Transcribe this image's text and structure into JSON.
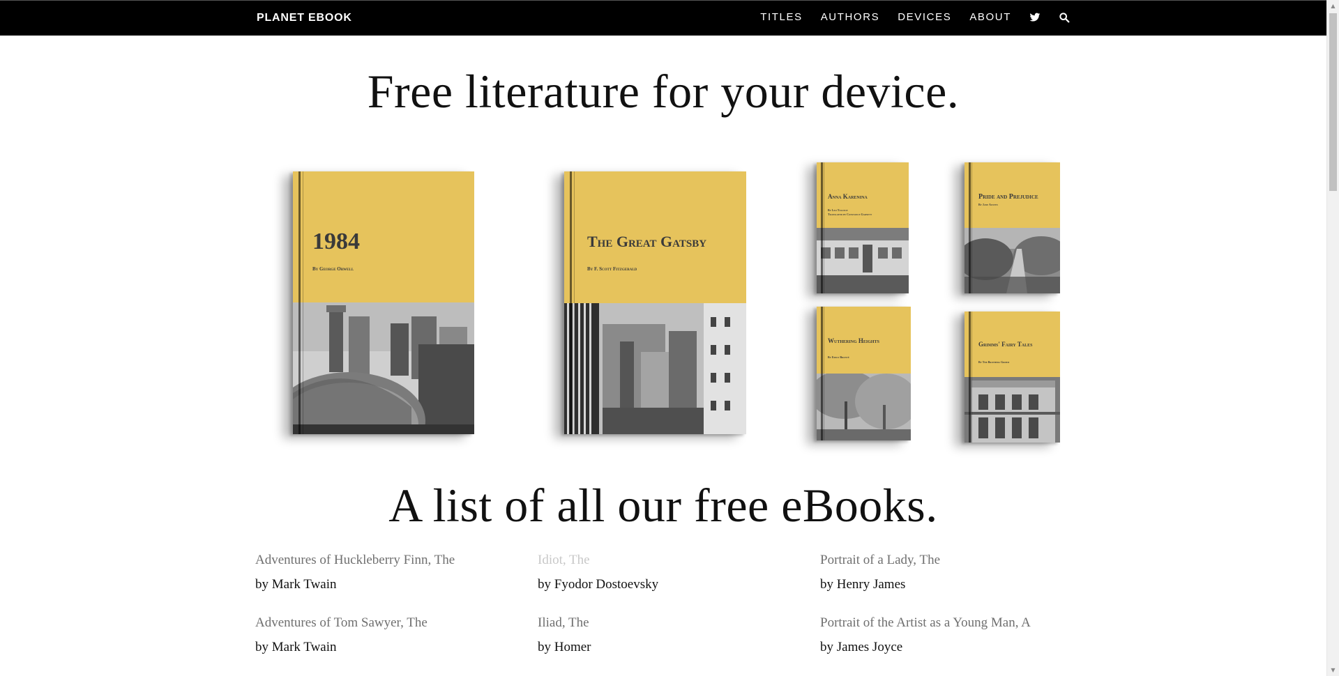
{
  "nav": {
    "brand": "PLANET EBOOK",
    "links": [
      "TITLES",
      "AUTHORS",
      "DEVICES",
      "ABOUT"
    ],
    "icons": [
      "twitter-icon",
      "search-icon"
    ]
  },
  "hero": {
    "title": "Free literature for your device."
  },
  "books": [
    {
      "title": "1984",
      "author": "By George Orwell"
    },
    {
      "title": "The Great Gatsby",
      "author": "By F. Scott Fitzgerald"
    },
    {
      "title": "Anna Karenina",
      "author": "By Leo Tolstoy",
      "author2": "Translated by Constance Garnett"
    },
    {
      "title": "Pride and Prejudice",
      "author": "By Jane Austen"
    },
    {
      "title": "Wuthering Heights",
      "author": "By Emily Brontë"
    },
    {
      "title": "Grimms' Fairy Tales",
      "author": "By The Brothers Grimm"
    }
  ],
  "list": {
    "title": "A list of all our free eBooks.",
    "items": [
      {
        "title": "Adventures of Huckleberry Finn, The",
        "author": "by Mark Twain"
      },
      {
        "title": "Idiot, The",
        "author": "by Fyodor Dostoevsky"
      },
      {
        "title": "Portrait of a Lady, The",
        "author": "by Henry James"
      },
      {
        "title": "Adventures of Tom Sawyer, The",
        "author": "by Mark Twain"
      },
      {
        "title": "Iliad, The",
        "author": "by Homer"
      },
      {
        "title": "Portrait of the Artist as a Young Man, A",
        "author": "by James Joyce"
      }
    ]
  },
  "colors": {
    "cover_yellow": "#e6c35c",
    "nav_bg": "#000000",
    "title_link": "#6f6f6f",
    "hover_link": "#c8c8c8"
  }
}
